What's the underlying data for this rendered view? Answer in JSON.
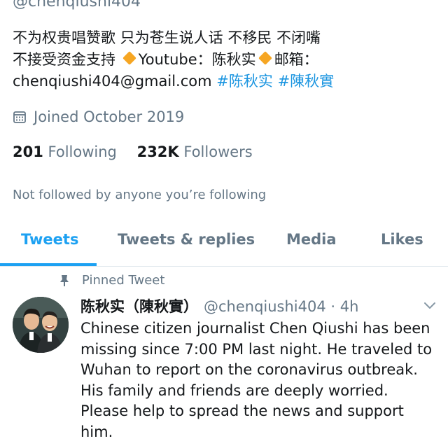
{
  "profile": {
    "handle": "@chenqiushi404",
    "bio_lines": [
      "不为权贵唱赞歌 只为苍生说人话 不移民 不闭嘴",
      "不接受资金支持",
      "Youtube：陈秋实",
      "邮箱：",
      "chenqiushi404@gmail.com",
      "#陈秋实",
      "#陳秋實"
    ],
    "joined": "Joined October 2019",
    "following_count": "201",
    "following_label": "Following",
    "followers_count": "232K",
    "followers_label": "Followers",
    "not_followed": "Not followed by anyone you’re following"
  },
  "tabs": [
    {
      "label": "Tweets",
      "active": true
    },
    {
      "label": "Tweets & replies"
    },
    {
      "label": "Media"
    },
    {
      "label": "Likes"
    }
  ],
  "tweet": {
    "pinned_label": "Pinned Tweet",
    "name": "陈秋实（陳秋實）",
    "handle_time": "@chenqiushi404 · 4h",
    "body_lines": [
      "Chinese citizen journalist Chen Qiushi has been",
      "missing since 7:00 PM last night. He traveled to",
      "Wuhan to report on the coronavirus outbreak.",
      "His family and friends are deeply worried.",
      "Please help to spread the news and support",
      "him."
    ]
  },
  "colors": {
    "accent": "#1da1f2",
    "hashtag": "#1b95e0",
    "muted": "#657786",
    "diamond": "#f6a623"
  },
  "icons": [
    "calendar-icon",
    "pin-icon",
    "chevron-down-icon",
    "diamond-icon"
  ]
}
